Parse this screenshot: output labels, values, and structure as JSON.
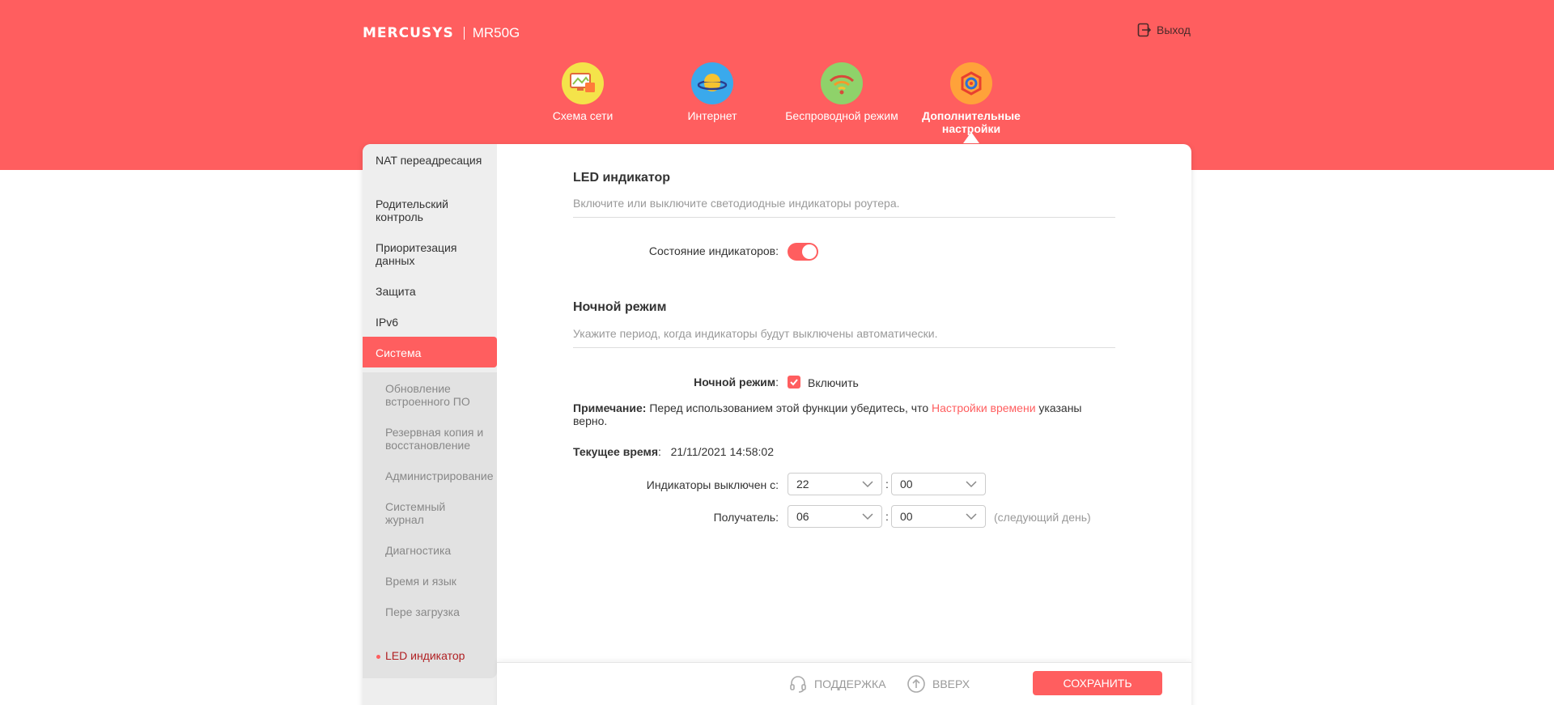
{
  "header": {
    "brand": "MERCUSYS",
    "model": "MR50G",
    "logout_label": "Выход"
  },
  "nav": {
    "items": [
      {
        "label": "Схема сети",
        "icon": "network-map-icon",
        "color": "#f4e34a"
      },
      {
        "label": "Интернет",
        "icon": "planet-icon",
        "color": "#3aa9ec"
      },
      {
        "label": "Беспроводной режим",
        "icon": "wifi-icon",
        "color": "#8fd26a"
      },
      {
        "label": "Дополнительные настройки",
        "icon": "gear-icon",
        "color": "#ffa23a",
        "active": true
      }
    ]
  },
  "sidebar": {
    "items": [
      {
        "label": "NAT переадресация"
      },
      {
        "label": "Родительский контроль"
      },
      {
        "label": "Приоритезация данных"
      },
      {
        "label": "Защита"
      },
      {
        "label": "IPv6"
      },
      {
        "label": "Система",
        "active": true
      }
    ],
    "subitems": [
      {
        "label": "Обновление встроенного ПО"
      },
      {
        "label": "Резервная копия и восстановление"
      },
      {
        "label": "Администрирование"
      },
      {
        "label": "Системный журнал"
      },
      {
        "label": "Диагностика"
      },
      {
        "label": "Время и язык"
      },
      {
        "label": "Пере загрузка"
      },
      {
        "label": "LED индикатор",
        "current": true
      }
    ]
  },
  "led_section": {
    "title": "LED индикатор",
    "description": "Включите или выключите светодиодные индикаторы роутера.",
    "status_label": "Состояние индикаторов:",
    "status_on": true
  },
  "night_section": {
    "title": "Ночной режим",
    "description": "Укажите период, когда индикаторы будут выключены автоматически.",
    "mode_label": "Ночной режим",
    "mode_colon": ":",
    "enable_label": "Включить",
    "enabled": true,
    "note_label": "Примечание:",
    "note_text_before": "Перед использованием этой функции убедитесь, что",
    "note_link": "Настройки времени",
    "note_text_after": "указаны верно.",
    "current_time_label": "Текущее время",
    "current_time_colon": ":",
    "current_time_value": "21/11/2021 14:58:02",
    "off_from_label": "Индикаторы выключен с:",
    "off_from_hour": "22",
    "off_from_minute": "00",
    "to_label": "Получатель:",
    "to_hour": "06",
    "to_minute": "00",
    "time_separator": ":",
    "next_day_hint": "(следующий день)"
  },
  "footer": {
    "support_label": "ПОДДЕРЖКА",
    "top_label": "ВВЕРХ",
    "save_label": "СОХРАНИТЬ"
  },
  "colors": {
    "accent": "#ff5e5f",
    "sidebar_bg": "#eeeeee",
    "current_item": "#b01f22"
  }
}
